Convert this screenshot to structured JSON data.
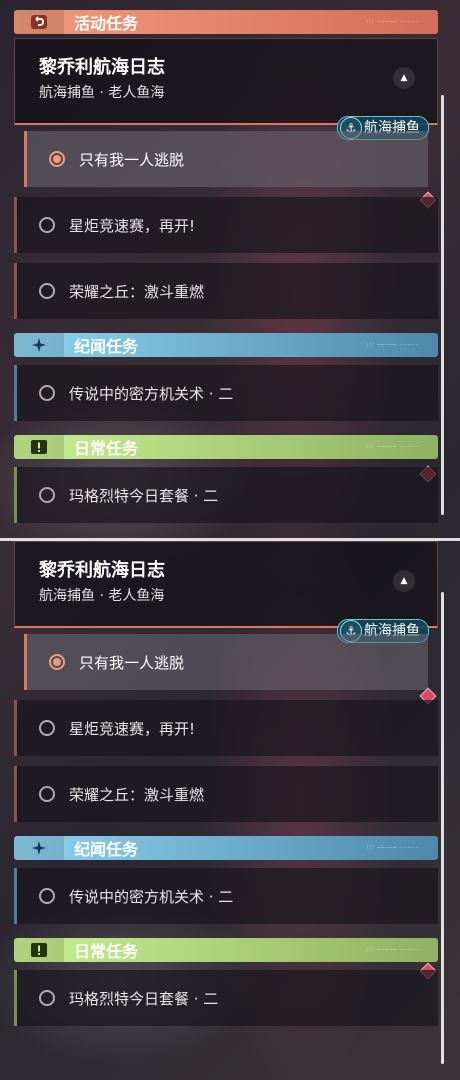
{
  "sections": {
    "activity": {
      "title": "活动任务"
    },
    "lore": {
      "title": "纪闻任务"
    },
    "daily": {
      "title": "日常任务"
    }
  },
  "journal": {
    "title": "黎乔利航海日志",
    "subtitle": "航海捕鱼 · 老人鱼海",
    "tag": "航海捕鱼"
  },
  "quests": {
    "active": "只有我一人逃脱",
    "q2": "星炬竞速赛，再开!",
    "q3": "荣耀之丘：激斗重燃",
    "lore1": "传说中的密方机关术 · 二",
    "daily1": "玛格烈特今日套餐 · 二"
  },
  "colors": {
    "activity_accent": "#f39b7c",
    "lore_accent": "#8fd3ef",
    "daily_accent": "#c8f090",
    "alert": "#d94c62"
  }
}
